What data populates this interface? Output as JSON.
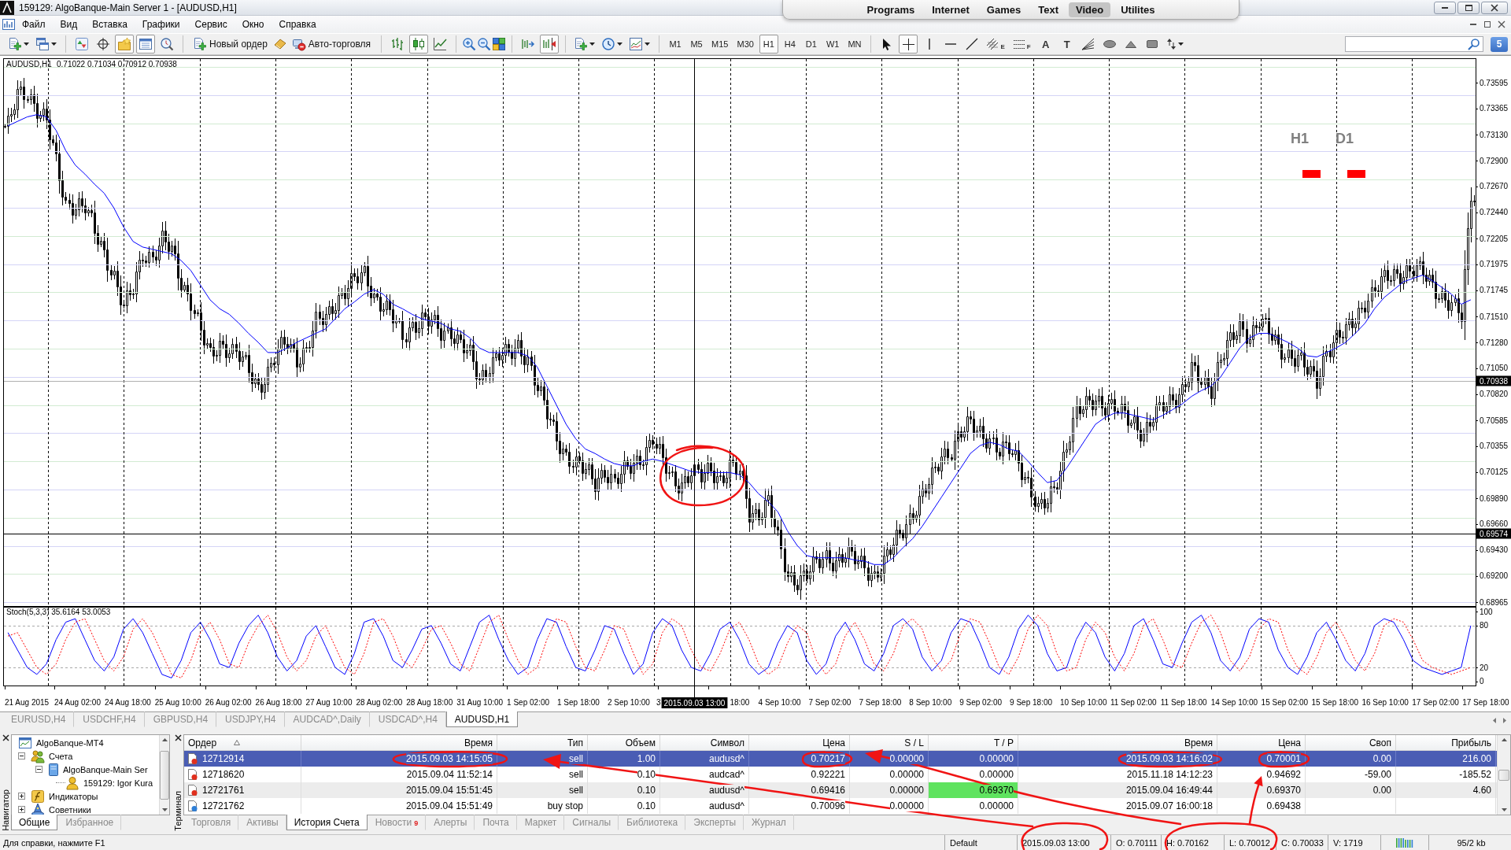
{
  "window": {
    "title": "159129: AlgoBanque-Main Server 1 - [AUDUSD,H1]"
  },
  "launcher": {
    "items": [
      {
        "label": "Programs",
        "selected": false
      },
      {
        "label": "Internet",
        "selected": false
      },
      {
        "label": "Games",
        "selected": false
      },
      {
        "label": "Text",
        "selected": false
      },
      {
        "label": "Video",
        "selected": true
      },
      {
        "label": "Utilites",
        "selected": false
      }
    ]
  },
  "menu": [
    "Файл",
    "Вид",
    "Вставка",
    "Графики",
    "Сервис",
    "Окно",
    "Справка"
  ],
  "toolbar": {
    "panels": [
      {
        "kind": "market_watch",
        "selected": false
      },
      {
        "kind": "data_window",
        "selected": false
      },
      {
        "kind": "navigator",
        "selected": true
      },
      {
        "kind": "terminal",
        "selected": true
      },
      {
        "kind": "tester",
        "selected": false
      }
    ],
    "order_button": "Новый ордер",
    "autotrading_button": "Авто-торговля",
    "chart_types": [
      {
        "kind": "bars",
        "selected": false
      },
      {
        "kind": "candles",
        "selected": true
      },
      {
        "kind": "line",
        "selected": false
      }
    ],
    "scroll": [
      {
        "kind": "autoscroll",
        "selected": false
      },
      {
        "kind": "shift",
        "selected": true
      }
    ],
    "timeframes": [
      {
        "label": "M1",
        "selected": false
      },
      {
        "label": "M5",
        "selected": false
      },
      {
        "label": "M15",
        "selected": false
      },
      {
        "label": "M30",
        "selected": false
      },
      {
        "label": "H1",
        "selected": true
      },
      {
        "label": "H4",
        "selected": false
      },
      {
        "label": "D1",
        "selected": false
      },
      {
        "label": "W1",
        "selected": false
      },
      {
        "label": "MN",
        "selected": false
      }
    ],
    "drawing_tools": [
      {
        "kind": "cursor",
        "selected": false
      },
      {
        "kind": "crosshair",
        "selected": true
      },
      {
        "kind": "vline",
        "selected": false
      },
      {
        "kind": "hline",
        "selected": false
      },
      {
        "kind": "trendline",
        "selected": false
      },
      {
        "kind": "channel",
        "glyph": "E",
        "selected": false
      },
      {
        "kind": "fibonacci",
        "glyph": "F",
        "selected": false
      },
      {
        "kind": "text",
        "glyph": "A",
        "selected": false
      },
      {
        "kind": "label",
        "glyph": "T",
        "selected": false
      },
      {
        "kind": "fan",
        "selected": false
      },
      {
        "kind": "ellipse",
        "selected": false
      },
      {
        "kind": "triangle",
        "selected": false
      },
      {
        "kind": "rectangle",
        "selected": false
      },
      {
        "kind": "arrows",
        "selected": false
      }
    ],
    "notifications": "5"
  },
  "chart": {
    "symbol": "AUDUSD,H1",
    "ohlc": "0.71022 0.71034 0.70912 0.70938",
    "signals": [
      {
        "label": "H1",
        "color": "#ff0000"
      },
      {
        "label": "D1",
        "color": "#ff0000"
      }
    ],
    "chart_data": {
      "type": "line",
      "grid": true,
      "ylim": [
        0.68923,
        0.73813
      ],
      "yticks": [
        {
          "value": 0.73595,
          "label": "0.73595"
        },
        {
          "value": 0.73365,
          "label": "0.73365"
        },
        {
          "value": 0.7313,
          "label": "0.73130"
        },
        {
          "value": 0.729,
          "label": "0.72900"
        },
        {
          "value": 0.7267,
          "label": "0.72670"
        },
        {
          "value": 0.7244,
          "label": "0.72440"
        },
        {
          "value": 0.72205,
          "label": "0.72205"
        },
        {
          "value": 0.71975,
          "label": "0.71975"
        },
        {
          "value": 0.71745,
          "label": "0.71745"
        },
        {
          "value": 0.7151,
          "label": "0.71510"
        },
        {
          "value": 0.7128,
          "label": "0.71280"
        },
        {
          "value": 0.7105,
          "label": "0.71050"
        },
        {
          "value": 0.7082,
          "label": "0.70820"
        },
        {
          "value": 0.70585,
          "label": "0.70585"
        },
        {
          "value": 0.70355,
          "label": "0.70355"
        },
        {
          "value": 0.70125,
          "label": "0.70125"
        },
        {
          "value": 0.6989,
          "label": "0.69890"
        },
        {
          "value": 0.6966,
          "label": "0.69660"
        },
        {
          "value": 0.6943,
          "label": "0.69430"
        },
        {
          "value": 0.692,
          "label": "0.69200"
        },
        {
          "value": 0.68965,
          "label": "0.68965"
        }
      ],
      "series": [
        {
          "color": "#0000ff",
          "values": [
            0.7321,
            0.7325,
            0.7329,
            0.7331,
            0.7329,
            0.7317,
            0.7299,
            0.7286,
            0.7278,
            0.7269,
            0.7261,
            0.7248,
            0.7231,
            0.7218,
            0.7213,
            0.7211,
            0.7209,
            0.7207,
            0.7201,
            0.7192,
            0.7179,
            0.7166,
            0.7158,
            0.7153,
            0.7145,
            0.7136,
            0.7128,
            0.7119,
            0.7119,
            0.7123,
            0.7128,
            0.7132,
            0.7136,
            0.714,
            0.7149,
            0.7158,
            0.7164,
            0.7171,
            0.7175,
            0.7171,
            0.7162,
            0.7158,
            0.7153,
            0.7149,
            0.7147,
            0.7145,
            0.714,
            0.7138,
            0.7132,
            0.7123,
            0.7119,
            0.7119,
            0.7119,
            0.7119,
            0.7116,
            0.7106,
            0.7089,
            0.7072,
            0.7055,
            0.7042,
            0.7033,
            0.7029,
            0.7024,
            0.702,
            0.7018,
            0.7018,
            0.7022,
            0.7024,
            0.7022,
            0.7019,
            0.7016,
            0.7013,
            0.7012,
            0.7012,
            0.7012,
            0.7012,
            0.701,
            0.7003,
            0.6993,
            0.6986,
            0.6977,
            0.696,
            0.6947,
            0.6938,
            0.6936,
            0.6936,
            0.6936,
            0.6936,
            0.6934,
            0.6933,
            0.693,
            0.693,
            0.6936,
            0.6945,
            0.6953,
            0.6964,
            0.6977,
            0.699,
            0.7003,
            0.7016,
            0.7029,
            0.7036,
            0.7039,
            0.7037,
            0.7033,
            0.7031,
            0.7022,
            0.7012,
            0.7003,
            0.7005,
            0.7016,
            0.7029,
            0.7042,
            0.7055,
            0.7061,
            0.7065,
            0.7065,
            0.7063,
            0.7061,
            0.7059,
            0.7063,
            0.7068,
            0.7073,
            0.708,
            0.7085,
            0.7089,
            0.7097,
            0.711,
            0.7123,
            0.7132,
            0.7136,
            0.7136,
            0.7132,
            0.7128,
            0.7123,
            0.7116,
            0.7115,
            0.7119,
            0.7123,
            0.7128,
            0.7136,
            0.7145,
            0.7158,
            0.7168,
            0.7175,
            0.7182,
            0.7185,
            0.7188,
            0.7183,
            0.7177,
            0.7171,
            0.7162,
            0.7166
          ]
        }
      ],
      "ref_lines": [
        {
          "axis": "y",
          "value": 0.70938,
          "label": "0.70938",
          "color": "#b0b0b0"
        },
        {
          "axis": "y",
          "value": 0.69574,
          "label": "0.69574",
          "color": "#000000"
        }
      ]
    },
    "crosshair_time": "2015.09.03 13:00",
    "time_labels": [
      "21 Aug 2015",
      "24 Aug 02:00",
      "24 Aug 18:00",
      "25 Aug 10:00",
      "26 Aug 02:00",
      "26 Aug 18:00",
      "27 Aug 10:00",
      "28 Aug 02:00",
      "28 Aug 18:00",
      "31 Aug 10:00",
      "1 Sep 02:00",
      "1 Sep 18:00",
      "2 Sep 10:00",
      "3",
      "18:00",
      "4 Sep 10:00",
      "7 Sep 02:00",
      "7 Sep 18:00",
      "8 Sep 10:00",
      "9 Sep 02:00",
      "9 Sep 18:00",
      "10 Sep 10:00",
      "11 Sep 02:00",
      "11 Sep 18:00",
      "14 Sep 10:00",
      "15 Sep 02:00",
      "15 Sep 18:00",
      "16 Sep 10:00",
      "17 Sep 02:00",
      "17 Sep 18:00"
    ],
    "indicator": {
      "label": "Stoch(5,3,3) 35.6164 53.0053",
      "chart_data": {
        "type": "line",
        "ylim": [
          -7,
          107
        ],
        "yticks": [
          {
            "value": 100,
            "label": "100"
          },
          {
            "value": 80,
            "label": "80"
          },
          {
            "value": 20,
            "label": "20"
          },
          {
            "value": 0,
            "label": "0"
          }
        ],
        "ref_lines": [
          {
            "axis": "y",
            "value": 80,
            "color": "#a8a8a8",
            "line_style": "dashed"
          },
          {
            "axis": "y",
            "value": 20,
            "color": "#a8a8a8",
            "line_style": "dashed"
          }
        ],
        "series": [
          {
            "color": "#0000ff",
            "values": [
              70,
              45,
              20,
              10,
              25,
              60,
              85,
              90,
              60,
              30,
              15,
              35,
              75,
              90,
              70,
              40,
              10,
              5,
              30,
              70,
              85,
              60,
              25,
              20,
              55,
              80,
              95,
              70,
              35,
              15,
              30,
              65,
              80,
              50,
              20,
              10,
              40,
              85,
              90,
              65,
              30,
              20,
              45,
              75,
              80,
              55,
              25,
              15,
              50,
              85,
              95,
              60,
              30,
              10,
              20,
              60,
              90,
              85,
              50,
              20,
              15,
              45,
              80,
              75,
              40,
              10,
              25,
              70,
              90,
              80,
              45,
              20,
              15,
              40,
              75,
              85,
              60,
              25,
              10,
              20,
              55,
              80,
              70,
              30,
              10,
              25,
              65,
              85,
              60,
              25,
              15,
              40,
              80,
              90,
              75,
              35,
              15,
              30,
              70,
              90,
              85,
              55,
              20,
              10,
              35,
              75,
              95,
              80,
              40,
              15,
              20,
              60,
              85,
              70,
              35,
              15,
              40,
              80,
              90,
              60,
              25,
              20,
              55,
              85,
              95,
              70,
              30,
              15,
              35,
              75,
              90,
              85,
              45,
              20,
              10,
              35,
              70,
              85,
              60,
              30,
              15,
              40,
              80,
              90,
              85,
              60,
              30,
              20,
              15,
              10,
              15,
              20,
              80
            ]
          },
          {
            "color": "#ff0000",
            "line_style": "dotted",
            "values": [
              65,
              70,
              45,
              20,
              10,
              25,
              60,
              85,
              90,
              60,
              30,
              15,
              35,
              75,
              90,
              70,
              40,
              10,
              5,
              30,
              70,
              85,
              60,
              25,
              20,
              55,
              80,
              95,
              70,
              35,
              15,
              30,
              65,
              80,
              50,
              20,
              10,
              40,
              85,
              90,
              65,
              30,
              20,
              45,
              75,
              80,
              55,
              25,
              15,
              50,
              85,
              95,
              60,
              30,
              10,
              20,
              60,
              90,
              85,
              50,
              20,
              15,
              45,
              80,
              75,
              40,
              10,
              25,
              70,
              90,
              80,
              45,
              20,
              15,
              40,
              75,
              85,
              60,
              25,
              10,
              20,
              55,
              80,
              70,
              30,
              10,
              25,
              65,
              85,
              60,
              25,
              15,
              40,
              80,
              90,
              75,
              35,
              15,
              30,
              70,
              90,
              85,
              55,
              20,
              10,
              35,
              75,
              95,
              80,
              40,
              15,
              20,
              60,
              85,
              70,
              35,
              15,
              40,
              80,
              90,
              60,
              25,
              20,
              55,
              85,
              95,
              70,
              30,
              15,
              35,
              75,
              90,
              85,
              45,
              20,
              10,
              35,
              70,
              85,
              60,
              30,
              15,
              40,
              80,
              90,
              85,
              60,
              30,
              20,
              15,
              10,
              15,
              20
            ]
          }
        ]
      }
    }
  },
  "chart_tabs": [
    {
      "label": "EURUSD,H4",
      "selected": false
    },
    {
      "label": "USDCHF,H4",
      "selected": false
    },
    {
      "label": "GBPUSD,H4",
      "selected": false
    },
    {
      "label": "USDJPY,H4",
      "selected": false
    },
    {
      "label": "AUDCAD^,Daily",
      "selected": false
    },
    {
      "label": "USDCAD^,H4",
      "selected": false
    },
    {
      "label": "AUDUSD,H1",
      "selected": true
    }
  ],
  "navigator": {
    "title": "Навигатор",
    "tree": [
      {
        "label": "AlgoBanque-MT4",
        "kind": "terminal",
        "children": [
          {
            "label": "Счета",
            "kind": "accounts",
            "expanded": true,
            "children": [
              {
                "label": "AlgoBanque-Main Ser",
                "kind": "server",
                "expanded": true,
                "children": [
                  {
                    "label": "159129: Igor Kura",
                    "kind": "account"
                  }
                ]
              }
            ]
          },
          {
            "label": "Индикаторы",
            "kind": "indicators",
            "expanded": false
          },
          {
            "label": "Советники",
            "kind": "experts",
            "expanded": false
          }
        ]
      }
    ],
    "tabs": [
      {
        "label": "Общие",
        "selected": true
      },
      {
        "label": "Избранное",
        "selected": false
      }
    ]
  },
  "terminal": {
    "title": "Терминал",
    "columns": [
      {
        "label": "Ордер",
        "sorted": true
      },
      {
        "label": "Время",
        "sorted": false
      },
      {
        "label": "Тип",
        "sorted": false
      },
      {
        "label": "Объем",
        "sorted": false
      },
      {
        "label": "Символ",
        "sorted": false
      },
      {
        "label": "Цена",
        "sorted": false
      },
      {
        "label": "S / L",
        "sorted": false
      },
      {
        "label": "T / P",
        "sorted": false
      },
      {
        "label": "Время",
        "sorted": false
      },
      {
        "label": "Цена",
        "sorted": false
      },
      {
        "label": "Своп",
        "sorted": false
      },
      {
        "label": "Прибыль",
        "sorted": false
      }
    ],
    "rows": [
      {
        "kind": "sell",
        "selected": true,
        "take_profit_hit": false,
        "order": "12712914",
        "open_time": "2015.09.03 14:15:05",
        "type": "sell",
        "volume": "1.00",
        "symbol": "audusd^",
        "open_price": "0.70217",
        "stop_loss": "0.00000",
        "take_profit": "0.00000",
        "close_time": "2015.09.03 14:16:02",
        "close_price": "0.70001",
        "swap": "0.00",
        "profit": "216.00"
      },
      {
        "kind": "sell",
        "selected": false,
        "take_profit_hit": false,
        "order": "12718620",
        "open_time": "2015.09.04 11:52:14",
        "type": "sell",
        "volume": "0.10",
        "symbol": "audcad^",
        "open_price": "0.92221",
        "stop_loss": "0.00000",
        "take_profit": "0.00000",
        "close_time": "2015.11.18 14:12:23",
        "close_price": "0.94692",
        "swap": "-59.00",
        "profit": "-185.52"
      },
      {
        "kind": "sell",
        "selected": false,
        "take_profit_hit": true,
        "order": "12721761",
        "open_time": "2015.09.04 15:51:45",
        "type": "sell",
        "volume": "0.10",
        "symbol": "audusd^",
        "open_price": "0.69416",
        "stop_loss": "0.00000",
        "take_profit": "0.69370",
        "close_time": "2015.09.04 16:49:44",
        "close_price": "0.69370",
        "swap": "0.00",
        "profit": "4.60"
      },
      {
        "kind": "buy",
        "selected": false,
        "take_profit_hit": false,
        "order": "12721762",
        "open_time": "2015.09.04 15:51:49",
        "type": "buy stop",
        "volume": "0.10",
        "symbol": "audusd^",
        "open_price": "0.70096",
        "stop_loss": "0.00000",
        "take_profit": "0.00000",
        "close_time": "2015.09.07 16:00:18",
        "close_price": "0.69438"
      }
    ],
    "tabs": [
      {
        "label": "Торговля",
        "selected": false
      },
      {
        "label": "Активы",
        "selected": false
      },
      {
        "label": "История Счета",
        "selected": true
      },
      {
        "label": "Новости",
        "badge": "9",
        "selected": false
      },
      {
        "label": "Алерты",
        "selected": false
      },
      {
        "label": "Почта",
        "selected": false
      },
      {
        "label": "Маркет",
        "selected": false
      },
      {
        "label": "Сигналы",
        "selected": false
      },
      {
        "label": "Библиотека",
        "selected": false
      },
      {
        "label": "Эксперты",
        "selected": false
      },
      {
        "label": "Журнал",
        "selected": false
      }
    ]
  },
  "status_bar": {
    "help": "Для справки, нажмите F1",
    "profile": "Default",
    "time": "2015.09.03 13:00",
    "open": "O: 0.70111",
    "high": "H: 0.70162",
    "low": "L: 0.70012",
    "close": "C: 0.70033",
    "volume": "V: 1719",
    "traffic": "95/2 kb"
  }
}
